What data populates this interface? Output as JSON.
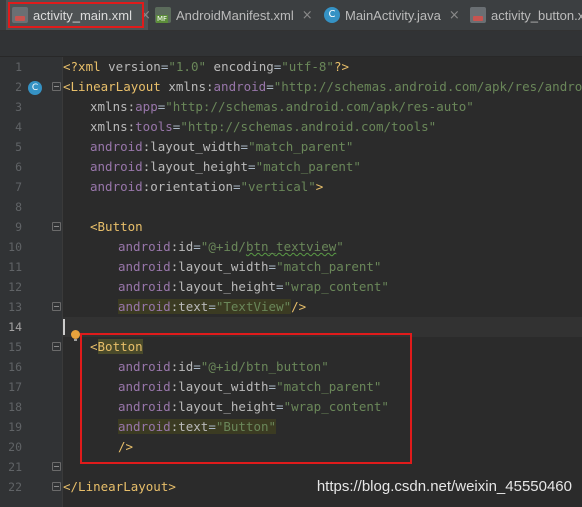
{
  "tabs": [
    {
      "label": "activity_main.xml",
      "icon": "xml-file-icon",
      "active": true
    },
    {
      "label": "AndroidManifest.xml",
      "icon": "manifest-file-icon",
      "active": false
    },
    {
      "label": "MainActivity.java",
      "icon": "java-class-icon",
      "active": false
    },
    {
      "label": "activity_button.xm",
      "icon": "xml-file-icon",
      "active": false
    }
  ],
  "tab_close_glyph": "×",
  "gutter": {
    "line_numbers": [
      "1",
      "2",
      "3",
      "4",
      "5",
      "6",
      "7",
      "8",
      "9",
      "10",
      "11",
      "12",
      "13",
      "14",
      "15",
      "16",
      "17",
      "18",
      "19",
      "20",
      "21",
      "22"
    ],
    "class_marker": "C"
  },
  "code": {
    "l1": {
      "a": "<?xml ",
      "b": "version",
      "c": "=",
      "d": "\"1.0\"",
      "e": " encoding",
      "f": "=",
      "g": "\"utf-8\"",
      "h": "?>"
    },
    "l2": {
      "a": "<LinearLayout ",
      "b": "xmlns:",
      "c": "android",
      "d": "=",
      "e": "\"http://schemas.android.com/apk/res/android\""
    },
    "l3": {
      "a": "xmlns:",
      "b": "app",
      "c": "=",
      "d": "\"http://schemas.android.com/apk/res-auto\""
    },
    "l4": {
      "a": "xmlns:",
      "b": "tools",
      "c": "=",
      "d": "\"http://schemas.android.com/tools\""
    },
    "l5": {
      "a": "android",
      "b": ":layout_width",
      "c": "=",
      "d": "\"match_parent\""
    },
    "l6": {
      "a": "android",
      "b": ":layout_height",
      "c": "=",
      "d": "\"match_parent\""
    },
    "l7": {
      "a": "android",
      "b": ":orientation",
      "c": "=",
      "d": "\"vertical\"",
      "e": ">"
    },
    "l9": {
      "a": "<Button"
    },
    "l10": {
      "a": "android",
      "b": ":id",
      "c": "=",
      "d": "\"@+id/",
      "e": "btn_textview",
      "f": "\""
    },
    "l11": {
      "a": "android",
      "b": ":layout_width",
      "c": "=",
      "d": "\"match_parent\""
    },
    "l12": {
      "a": "android",
      "b": ":layout_height",
      "c": "=",
      "d": "\"wrap_content\""
    },
    "l13": {
      "a": "android",
      "b": ":text",
      "c": "=",
      "d": "\"TextView\"",
      "e": "/>"
    },
    "l15": {
      "a": "<",
      "b": "Botton"
    },
    "l16": {
      "a": "android",
      "b": ":id",
      "c": "=",
      "d": "\"@+id/btn_button\""
    },
    "l17": {
      "a": "android",
      "b": ":layout_width",
      "c": "=",
      "d": "\"match_parent\""
    },
    "l18": {
      "a": "android",
      "b": ":layout_height",
      "c": "=",
      "d": "\"wrap_content\""
    },
    "l19": {
      "a": "android",
      "b": ":text",
      "c": "=",
      "d": "\"Button\""
    },
    "l20": {
      "a": "/>"
    },
    "l22": {
      "a": "</LinearLayout>"
    }
  },
  "watermark": "https://blog.csdn.net/weixin_45550460"
}
